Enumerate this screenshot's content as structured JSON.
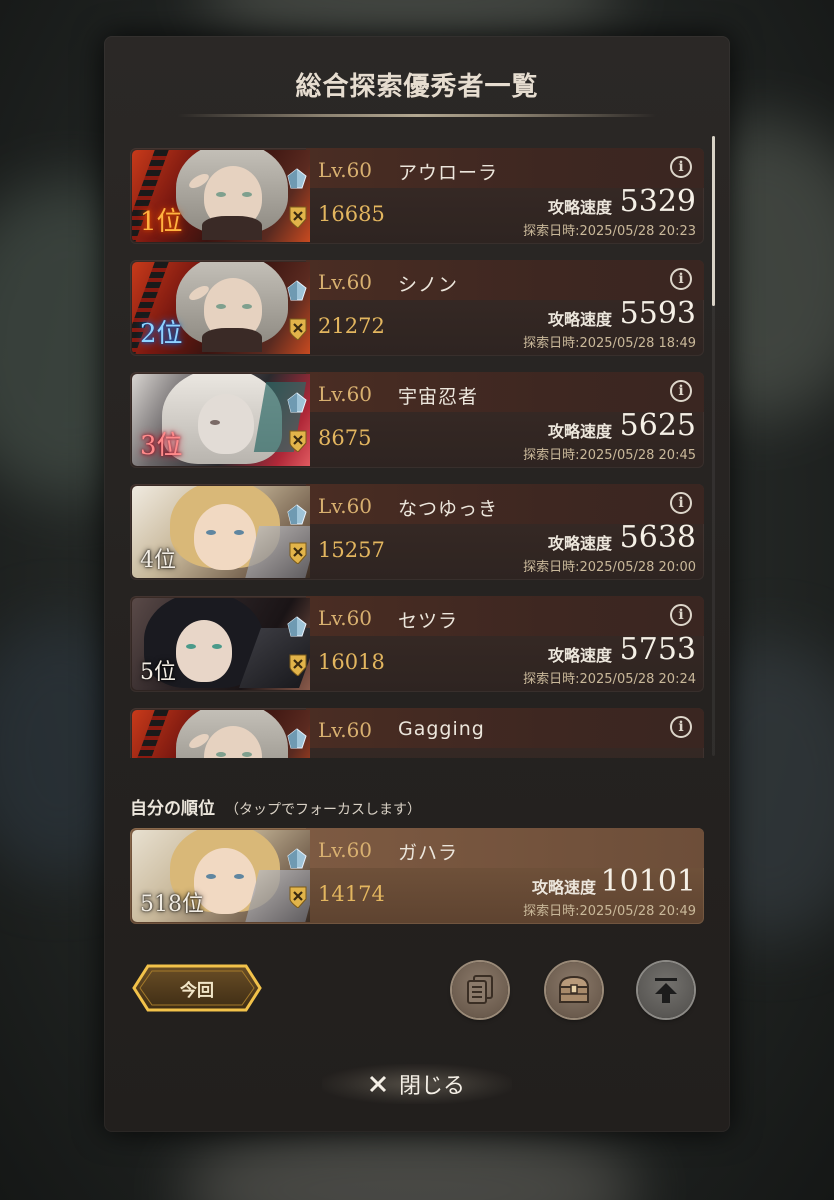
{
  "title": "総合探索優秀者一覧",
  "ranking": [
    {
      "rank": "1位",
      "rank_style": "gold",
      "level": "Lv.60",
      "name": "アウローラ",
      "power": "16685",
      "speed_label": "攻略速度",
      "speed": "5329",
      "date": "探索日時:2025/05/28 20:23",
      "portrait": "elf"
    },
    {
      "rank": "2位",
      "rank_style": "blue",
      "level": "Lv.60",
      "name": "シノン",
      "power": "21272",
      "speed_label": "攻略速度",
      "speed": "5593",
      "date": "探索日時:2025/05/28 18:49",
      "portrait": "elf"
    },
    {
      "rank": "3位",
      "rank_style": "red",
      "level": "Lv.60",
      "name": "宇宙忍者",
      "power": "8675",
      "speed_label": "攻略速度",
      "speed": "5625",
      "date": "探索日時:2025/05/28 20:45",
      "portrait": "white"
    },
    {
      "rank": "4位",
      "rank_style": "plain",
      "level": "Lv.60",
      "name": "なつゆっき",
      "power": "15257",
      "speed_label": "攻略速度",
      "speed": "5638",
      "date": "探索日時:2025/05/28 20:00",
      "portrait": "blonde"
    },
    {
      "rank": "5位",
      "rank_style": "plain",
      "level": "Lv.60",
      "name": "セツラ",
      "power": "16018",
      "speed_label": "攻略速度",
      "speed": "5753",
      "date": "探索日時:2025/05/28 20:24",
      "portrait": "dark"
    },
    {
      "rank": "",
      "rank_style": "plain",
      "level": "Lv.60",
      "name": "Gagging",
      "power": "",
      "speed_label": "",
      "speed": "",
      "date": "",
      "portrait": "elf"
    }
  ],
  "my_rank": {
    "label": "自分の順位",
    "hint": "（タップでフォーカスします）",
    "rank": "518位",
    "level": "Lv.60",
    "name": "ガハラ",
    "power": "14174",
    "speed_label": "攻略速度",
    "speed": "10101",
    "date": "探索日時:2025/05/28 20:49"
  },
  "buttons": {
    "current": "今回",
    "close": "閉じる"
  },
  "icons": {
    "info": "info-icon",
    "crystal": "crystal-icon",
    "shield": "shield-icon",
    "document": "document-icon",
    "chest": "treasure-chest-icon",
    "top": "scroll-to-top-icon",
    "close": "close-icon"
  },
  "colors": {
    "gold_rank": "#ffb340",
    "blue_rank": "#8fd2ff",
    "red_rank": "#ff8a8a",
    "level_text": "#d8b070",
    "power_text": "#e3b65f"
  }
}
